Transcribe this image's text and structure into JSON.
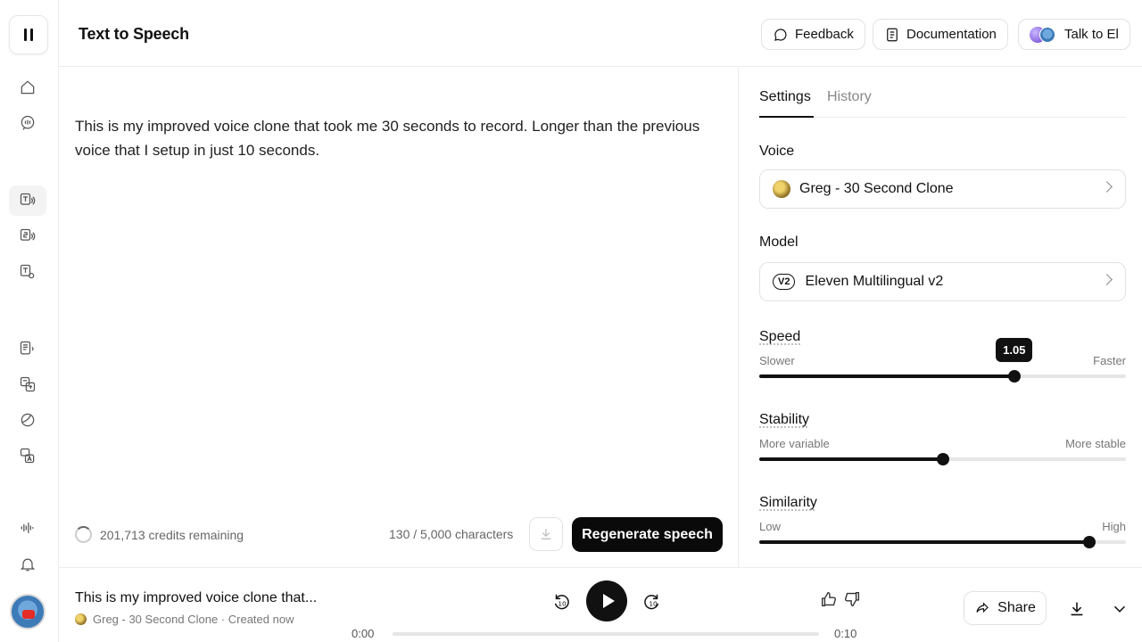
{
  "header": {
    "title": "Text to Speech",
    "feedback_label": "Feedback",
    "docs_label": "Documentation",
    "talk_label": "Talk to El"
  },
  "editor": {
    "text": "This is my improved voice clone that took me 30 seconds to record. Longer than the previous voice that I setup in just 10 seconds.",
    "credits": "201,713 credits remaining",
    "char_count": "130 / 5,000 characters",
    "regenerate_label": "Regenerate speech"
  },
  "settings": {
    "tabs": [
      {
        "label": "Settings",
        "active": true
      },
      {
        "label": "History",
        "active": false
      }
    ],
    "voice_label": "Voice",
    "voice_value": "Greg - 30 Second Clone",
    "model_label": "Model",
    "model_badge": "V2",
    "model_value": "Eleven Multilingual v2",
    "speed": {
      "label": "Speed",
      "min_label": "Slower",
      "max_label": "Faster",
      "value": 0.695,
      "tooltip": "1.05"
    },
    "stability": {
      "label": "Stability",
      "min_label": "More variable",
      "max_label": "More stable",
      "value": 0.5
    },
    "similarity": {
      "label": "Similarity",
      "min_label": "Low",
      "max_label": "High",
      "value": 0.9
    }
  },
  "player": {
    "title": "This is my improved voice clone that...",
    "subtitle": "Greg - 30 Second Clone · Created now",
    "rewind_label": "10",
    "forward_label": "10",
    "time_current": "0:00",
    "time_total": "0:10",
    "share_label": "Share"
  },
  "icons": {
    "sidebar": [
      "home-icon",
      "voice-chat-icon",
      "text-to-speech-icon",
      "speech-to-speech-icon",
      "text-settings-icon",
      "document-audio-icon",
      "translate-icon",
      "check-circle-icon",
      "dubbing-icon",
      "waveform-icon",
      "bell-icon"
    ]
  }
}
